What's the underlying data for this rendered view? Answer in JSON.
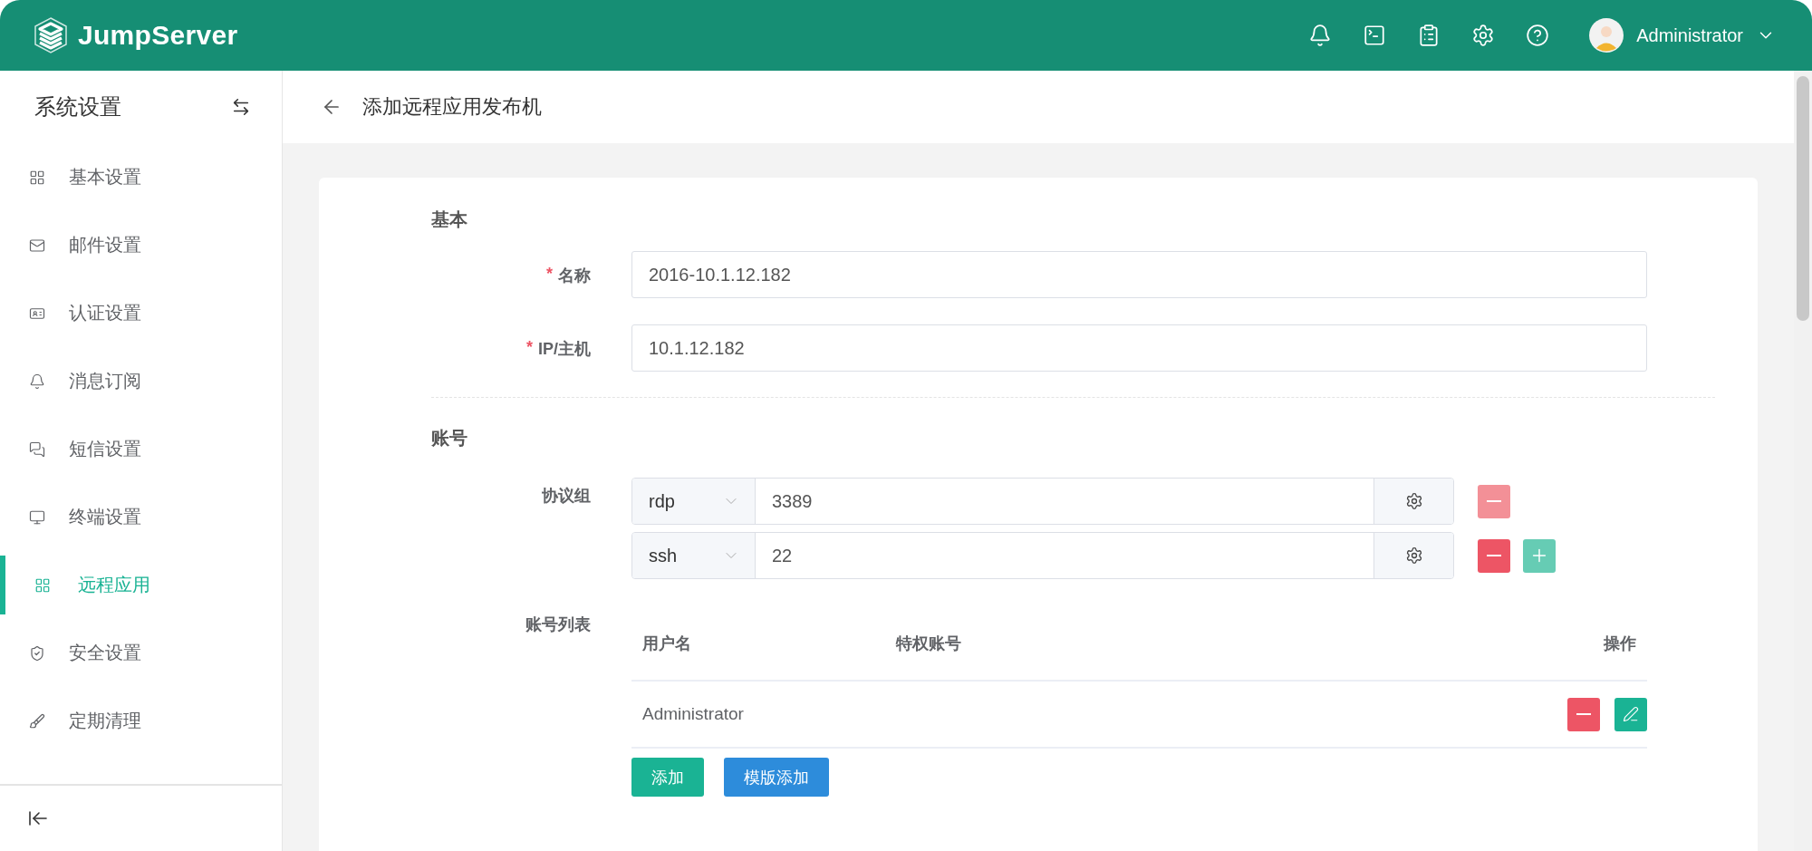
{
  "header": {
    "brand": "JumpServer",
    "user": "Administrator"
  },
  "sidebar": {
    "title": "系统设置",
    "items": [
      {
        "label": "基本设置",
        "selected": false
      },
      {
        "label": "邮件设置",
        "selected": false
      },
      {
        "label": "认证设置",
        "selected": false
      },
      {
        "label": "消息订阅",
        "selected": false
      },
      {
        "label": "短信设置",
        "selected": false
      },
      {
        "label": "终端设置",
        "selected": false
      },
      {
        "label": "远程应用",
        "selected": true
      },
      {
        "label": "安全设置",
        "selected": false
      },
      {
        "label": "定期清理",
        "selected": false
      }
    ]
  },
  "page": {
    "title": "添加远程应用发布机"
  },
  "form": {
    "sections": [
      {
        "title": "基本"
      },
      {
        "title": "账号"
      }
    ],
    "fields": [
      {
        "label": "名称",
        "required_mark": "*",
        "value": "2016-10.1.12.182"
      },
      {
        "label": "IP/主机",
        "required_mark": "*",
        "value": "10.1.12.182"
      }
    ],
    "protocols_label": "协议组",
    "protocols": [
      {
        "name": "rdp",
        "port": "3389",
        "remove_disabled": true,
        "add_button": false
      },
      {
        "name": "ssh",
        "port": "22",
        "remove_disabled": false,
        "add_button": true
      }
    ],
    "accounts_label": "账号列表",
    "accounts_table": {
      "columns": [
        "用户名",
        "特权账号",
        "操作"
      ],
      "rows": [
        {
          "username": "Administrator"
        }
      ]
    },
    "buttons": [
      {
        "label": "添加",
        "kind": "primary"
      },
      {
        "label": "模版添加",
        "kind": "info"
      }
    ]
  }
}
